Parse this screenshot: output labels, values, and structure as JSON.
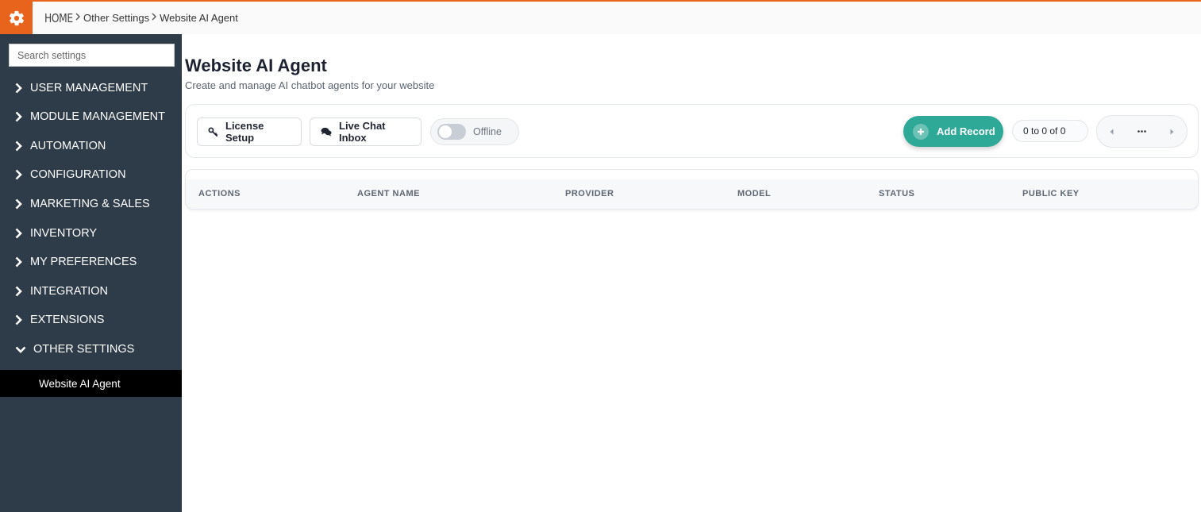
{
  "breadcrumb": {
    "home": "HOME",
    "items": [
      "Other Settings",
      "Website AI Agent"
    ]
  },
  "sidebar": {
    "search_placeholder": "Search settings",
    "items": [
      {
        "label": "USER MANAGEMENT",
        "expanded": false
      },
      {
        "label": "MODULE MANAGEMENT",
        "expanded": false
      },
      {
        "label": "AUTOMATION",
        "expanded": false
      },
      {
        "label": "CONFIGURATION",
        "expanded": false
      },
      {
        "label": "MARKETING & SALES",
        "expanded": false
      },
      {
        "label": "INVENTORY",
        "expanded": false
      },
      {
        "label": "MY PREFERENCES",
        "expanded": false
      },
      {
        "label": "INTEGRATION",
        "expanded": false
      },
      {
        "label": "EXTENSIONS",
        "expanded": false
      },
      {
        "label": "OTHER SETTINGS",
        "expanded": true
      }
    ],
    "active_subitem": "Website AI Agent"
  },
  "page": {
    "title": "Website AI Agent",
    "subtitle": "Create and manage AI chatbot agents for your website"
  },
  "toolbar": {
    "license_label": "License Setup",
    "inbox_label": "Live Chat Inbox",
    "status_label": "Offline",
    "status_on": false,
    "add_label": "Add Record",
    "count_label": "0 to 0 of 0"
  },
  "table": {
    "columns": [
      "ACTIONS",
      "AGENT NAME",
      "PROVIDER",
      "MODEL",
      "STATUS",
      "PUBLIC KEY"
    ]
  },
  "colors": {
    "accent": "#e8631c",
    "sidebar": "#2e3b48",
    "add_button": "#2ea897"
  }
}
